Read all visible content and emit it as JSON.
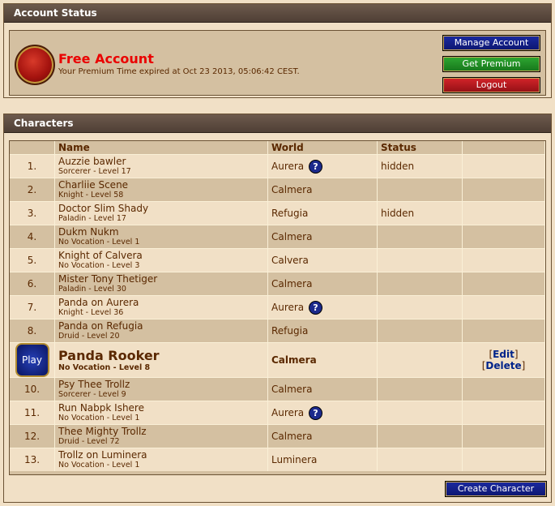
{
  "account": {
    "header": "Account Status",
    "title": "Free Account",
    "subtitle": "Your Premium Time expired at Oct 23 2013, 05:06:42 CEST.",
    "buttons": {
      "manage": "Manage Account",
      "premium": "Get Premium",
      "logout": "Logout"
    }
  },
  "characters": {
    "header": "Characters",
    "columns": {
      "name": "Name",
      "world": "World",
      "status": "Status"
    },
    "help_glyph": "?",
    "play_label": "Play",
    "edit_label": "Edit",
    "delete_label": "Delete",
    "create_label": "Create Character",
    "rows": [
      {
        "num": "1.",
        "name": "Auzzie bawler",
        "voc": "Sorcerer - Level 17",
        "world": "Aurera",
        "help": true,
        "status": "hidden"
      },
      {
        "num": "2.",
        "name": "Charliie Scene",
        "voc": "Knight - Level 58",
        "world": "Calmera",
        "help": false,
        "status": ""
      },
      {
        "num": "3.",
        "name": "Doctor Slim Shady",
        "voc": "Paladin - Level 17",
        "world": "Refugia",
        "help": false,
        "status": "hidden"
      },
      {
        "num": "4.",
        "name": "Dukm Nukm",
        "voc": "No Vocation - Level 1",
        "world": "Calmera",
        "help": false,
        "status": ""
      },
      {
        "num": "5.",
        "name": "Knight of Calvera",
        "voc": "No Vocation - Level 3",
        "world": "Calvera",
        "help": false,
        "status": ""
      },
      {
        "num": "6.",
        "name": "Mister Tony Thetiger",
        "voc": "Paladin - Level 30",
        "world": "Calmera",
        "help": false,
        "status": ""
      },
      {
        "num": "7.",
        "name": "Panda on Aurera",
        "voc": "Knight - Level 36",
        "world": "Aurera",
        "help": true,
        "status": ""
      },
      {
        "num": "8.",
        "name": "Panda on Refugia",
        "voc": "Druid - Level 20",
        "world": "Refugia",
        "help": false,
        "status": ""
      },
      {
        "num": "",
        "name": "Panda Rooker",
        "voc": "No Vocation - Level 8",
        "world": "Calmera",
        "help": false,
        "status": "",
        "selected": true
      },
      {
        "num": "10.",
        "name": "Psy Thee Trollz",
        "voc": "Sorcerer - Level 9",
        "world": "Calmera",
        "help": false,
        "status": ""
      },
      {
        "num": "11.",
        "name": "Run Nabpk Ishere",
        "voc": "No Vocation - Level 1",
        "world": "Aurera",
        "help": true,
        "status": ""
      },
      {
        "num": "12.",
        "name": "Thee Mighty Trollz",
        "voc": "Druid - Level 72",
        "world": "Calmera",
        "help": false,
        "status": ""
      },
      {
        "num": "13.",
        "name": "Trollz on Luminera",
        "voc": "No Vocation - Level 1",
        "world": "Luminera",
        "help": false,
        "status": ""
      }
    ]
  }
}
